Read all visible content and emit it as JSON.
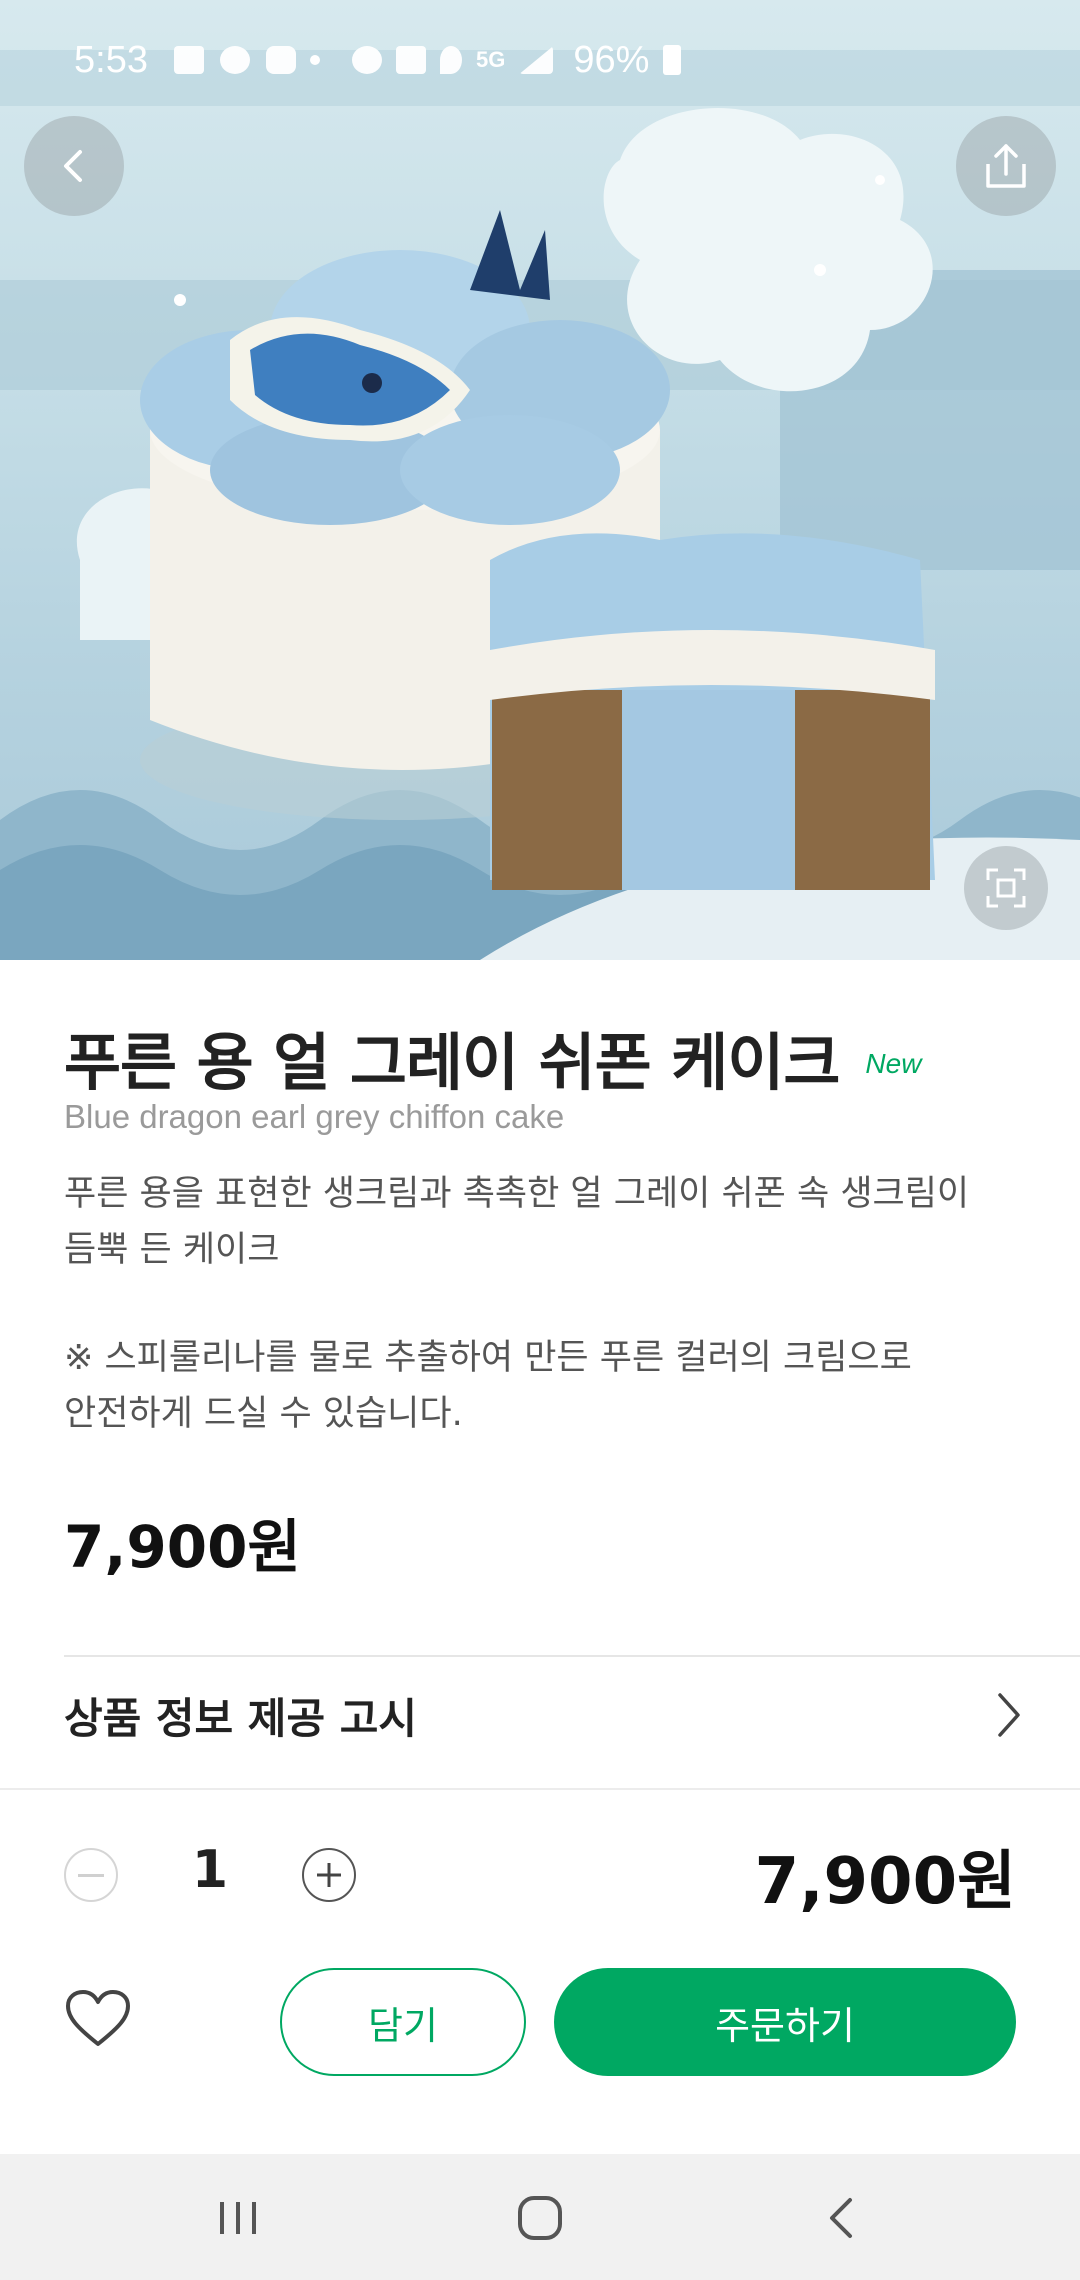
{
  "status_bar": {
    "time": "5:53",
    "battery": "96%",
    "network": "5G"
  },
  "product": {
    "name_ko": "푸른 용 얼 그레이 쉬폰 케이크",
    "badge": "New",
    "name_en": "Blue dragon earl grey chiffon cake",
    "description_line1": "푸른 용을 표현한 생크림과 촉촉한 얼 그레이 쉬폰 속 생크림이",
    "description_line2": "듬뿍 든 케이크",
    "note_line1": "※ 스피룰리나를 물로 추출하여 만든 푸른 컬러의 크림으로",
    "note_line2": "안전하게 드실 수 있습니다.",
    "price": "7,900원"
  },
  "notice": {
    "label": "상품 정보 제공 고시"
  },
  "order": {
    "quantity": "1",
    "total": "7,900원",
    "cart_label": "담기",
    "order_label": "주문하기"
  },
  "colors": {
    "brand_green": "#00a862",
    "hero_bg": "#c4dde6",
    "cream_blue": "#a9cde6"
  },
  "icons": {
    "back": "chevron-left-icon",
    "share": "share-icon",
    "expand": "expand-icon",
    "minus": "minus-circle-icon",
    "plus": "plus-circle-icon",
    "heart": "heart-icon",
    "notice_chevron": "chevron-right-icon"
  }
}
